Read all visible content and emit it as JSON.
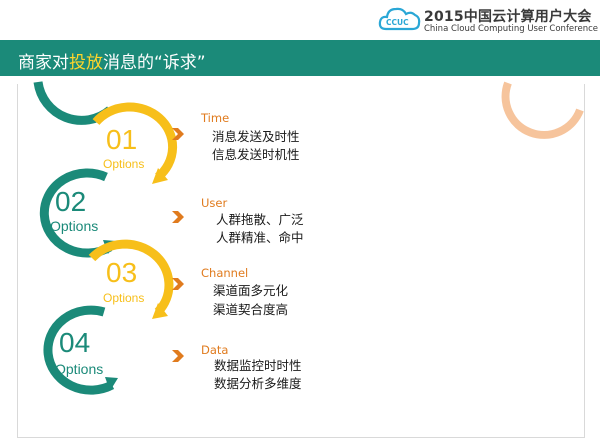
{
  "header": {
    "conference_title": "2015中国云计算用户大会",
    "conference_subtitle": "China Cloud Computing User Conference",
    "logo_text": "CCUC"
  },
  "title": {
    "before": "商家对",
    "highlight": "投放",
    "after": "消息的“诉求”"
  },
  "steps": [
    {
      "number": "01",
      "caption": "Options",
      "label": "Time",
      "items": [
        "消息发送及时性",
        "信息发送时机性"
      ]
    },
    {
      "number": "02",
      "caption": "Options",
      "label": "User",
      "items": [
        "人群拖散、广泛",
        "人群精准、命中"
      ]
    },
    {
      "number": "03",
      "caption": "Options",
      "label": "Channel",
      "items": [
        "渠道面多元化",
        "渠道契合度高"
      ]
    },
    {
      "number": "04",
      "caption": "Options",
      "label": "Data",
      "items": [
        "数据监控时时性",
        "数据分析多维度"
      ]
    }
  ],
  "colors": {
    "teal": "#1b8a79",
    "yellow": "#f7bf1a",
    "orange": "#e07b1e",
    "peach": "#f6c49c",
    "highlight": "#ffd52b"
  },
  "icons": [
    "cloud-logo-icon",
    "chevron-right-icon"
  ]
}
